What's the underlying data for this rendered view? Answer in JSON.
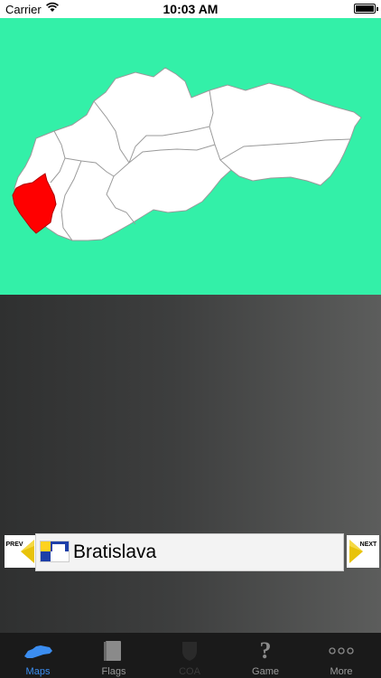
{
  "status_bar": {
    "carrier": "Carrier",
    "time": "10:03 AM"
  },
  "map": {
    "background": "#33f0a8",
    "highlight_color": "#ff0000",
    "region_color": "#ffffff"
  },
  "navigation": {
    "prev_label": "PREV",
    "next_label": "NEXT",
    "region_name": "Bratislava"
  },
  "tabs": [
    {
      "label": "Maps",
      "icon": "map-icon",
      "state": "active"
    },
    {
      "label": "Flags",
      "icon": "flag-book-icon",
      "state": "normal"
    },
    {
      "label": "COA",
      "icon": "coat-of-arms-icon",
      "state": "disabled"
    },
    {
      "label": "Game",
      "icon": "question-mark-icon",
      "state": "normal"
    },
    {
      "label": "More",
      "icon": "more-dots-icon",
      "state": "normal"
    }
  ]
}
